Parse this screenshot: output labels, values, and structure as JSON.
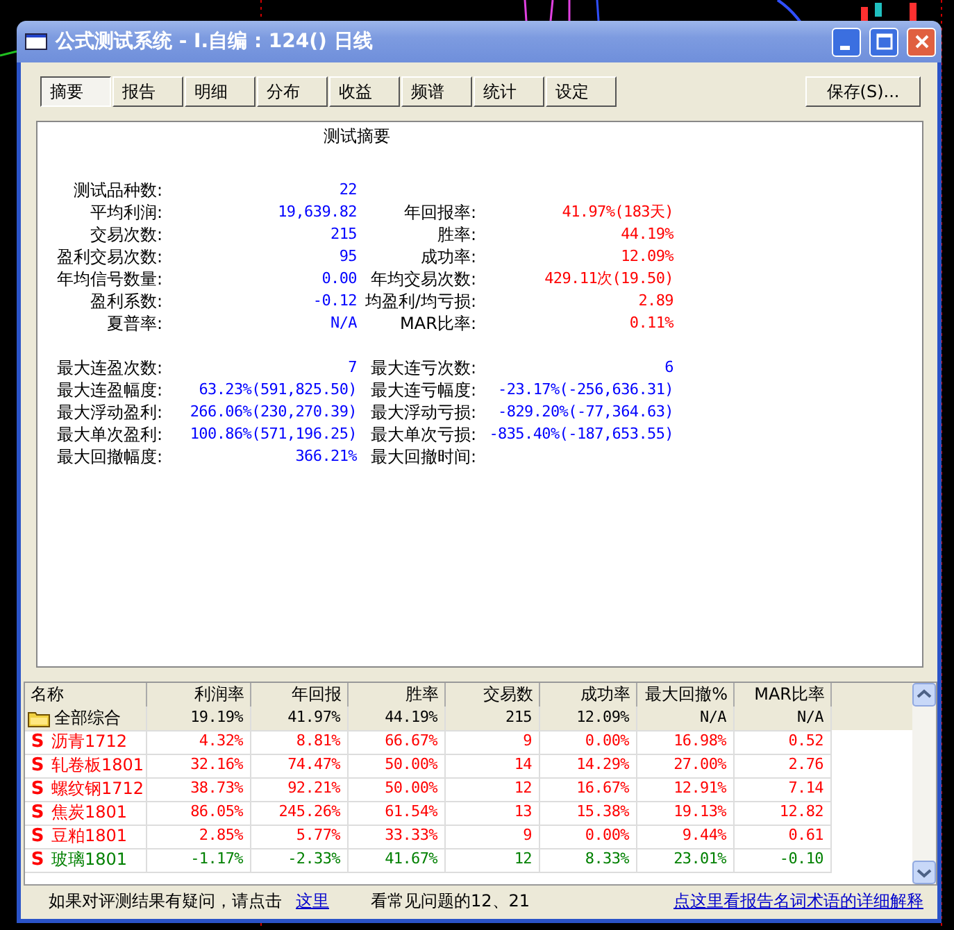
{
  "window": {
    "title": "公式测试系统 - I.自编 : 124() 日线"
  },
  "tabs": [
    {
      "label": "摘要",
      "selected": true
    },
    {
      "label": "报告",
      "selected": false
    },
    {
      "label": "明细",
      "selected": false
    },
    {
      "label": "分布",
      "selected": false
    },
    {
      "label": "收益",
      "selected": false
    },
    {
      "label": "频谱",
      "selected": false
    },
    {
      "label": "统计",
      "selected": false
    },
    {
      "label": "设定",
      "selected": false
    }
  ],
  "save_button": "保存(S)...",
  "summary": {
    "title": "测试摘要",
    "groups": [
      [
        {
          "left": {
            "label": "测试品种数:",
            "value": "22",
            "color": "#0000ff"
          }
        },
        {
          "left": {
            "label": "平均利润:",
            "value": "19,639.82",
            "color": "#0000ff"
          },
          "right": {
            "label": "年回报率:",
            "value": "41.97%(183天)",
            "color": "#ff0000"
          }
        },
        {
          "left": {
            "label": "交易次数:",
            "value": "215",
            "color": "#0000ff"
          },
          "right": {
            "label": "胜率:",
            "value": "44.19%",
            "color": "#ff0000"
          }
        },
        {
          "left": {
            "label": "盈利交易次数:",
            "value": "95",
            "color": "#0000ff"
          },
          "right": {
            "label": "成功率:",
            "value": "12.09%",
            "color": "#ff0000"
          }
        },
        {
          "left": {
            "label": "年均信号数量:",
            "value": "0.00",
            "color": "#0000ff"
          },
          "right": {
            "label": "年均交易次数:",
            "value": "429.11次(19.50)",
            "color": "#ff0000"
          }
        },
        {
          "left": {
            "label": "盈利系数:",
            "value": "-0.12",
            "color": "#0000ff"
          },
          "right": {
            "label": "均盈利/均亏损:",
            "value": "2.89",
            "color": "#ff0000"
          }
        },
        {
          "left": {
            "label": "夏普率:",
            "value": "N/A",
            "color": "#0000ff"
          },
          "right": {
            "label": "MAR比率:",
            "value": "0.11%",
            "color": "#ff0000"
          }
        }
      ],
      [
        {
          "left": {
            "label": "最大连盈次数:",
            "value": "7",
            "color": "#0000ff"
          },
          "right": {
            "label": "最大连亏次数:",
            "value": "6",
            "color": "#0000ff"
          }
        },
        {
          "left": {
            "label": "最大连盈幅度:",
            "value": "63.23%(591,825.50)",
            "color": "#0000ff"
          },
          "right": {
            "label": "最大连亏幅度:",
            "value": "-23.17%(-256,636.31)",
            "color": "#0000ff"
          }
        },
        {
          "left": {
            "label": "最大浮动盈利:",
            "value": "266.06%(230,270.39)",
            "color": "#0000ff"
          },
          "right": {
            "label": "最大浮动亏损:",
            "value": "-829.20%(-77,364.63)",
            "color": "#0000ff"
          }
        },
        {
          "left": {
            "label": "最大单次盈利:",
            "value": "100.86%(571,196.25)",
            "color": "#0000ff"
          },
          "right": {
            "label": "最大单次亏损:",
            "value": "-835.40%(-187,653.55)",
            "color": "#0000ff"
          }
        },
        {
          "left": {
            "label": "最大回撤幅度:",
            "value": "366.21%",
            "color": "#0000ff"
          },
          "right": {
            "label": "最大回撤时间:"
          }
        }
      ]
    ]
  },
  "table": {
    "columns": [
      "名称",
      "利润率",
      "年回报",
      "胜率",
      "交易数",
      "成功率",
      "最大回撤%",
      "MAR比率"
    ],
    "rows": [
      {
        "kind": "group",
        "selected": true,
        "color": "#000000",
        "cells": [
          "全部综合",
          "19.19%",
          "41.97%",
          "44.19%",
          "215",
          "12.09%",
          "N/A",
          "N/A"
        ]
      },
      {
        "kind": "item",
        "selected": false,
        "marker": "S",
        "color": "#ff0000",
        "cells": [
          "沥青1712",
          "4.32%",
          "8.81%",
          "66.67%",
          "9",
          "0.00%",
          "16.98%",
          "0.52"
        ]
      },
      {
        "kind": "item",
        "selected": false,
        "marker": "S",
        "color": "#ff0000",
        "cells": [
          "轧卷板1801",
          "32.16%",
          "74.47%",
          "50.00%",
          "14",
          "14.29%",
          "27.00%",
          "2.76"
        ]
      },
      {
        "kind": "item",
        "selected": false,
        "marker": "S",
        "color": "#ff0000",
        "cells": [
          "螺纹钢1712",
          "38.73%",
          "92.21%",
          "50.00%",
          "12",
          "16.67%",
          "12.91%",
          "7.14"
        ]
      },
      {
        "kind": "item",
        "selected": false,
        "marker": "S",
        "color": "#ff0000",
        "cells": [
          "焦炭1801",
          "86.05%",
          "245.26%",
          "61.54%",
          "13",
          "15.38%",
          "19.13%",
          "12.82"
        ]
      },
      {
        "kind": "item",
        "selected": false,
        "marker": "S",
        "color": "#ff0000",
        "cells": [
          "豆粕1801",
          "2.85%",
          "5.77%",
          "33.33%",
          "9",
          "0.00%",
          "9.44%",
          "0.61"
        ]
      },
      {
        "kind": "item",
        "selected": false,
        "marker": "S",
        "color": "#008000",
        "cells": [
          "玻璃1801",
          "-1.17%",
          "-2.33%",
          "41.67%",
          "12",
          "8.33%",
          "23.01%",
          "-0.10"
        ]
      }
    ]
  },
  "footer": {
    "text": "如果对评测结果有疑问，请点击",
    "link": "这里",
    "note": "看常见问题的12、21",
    "help_link": "点这里看报告名词术语的详细解释"
  }
}
